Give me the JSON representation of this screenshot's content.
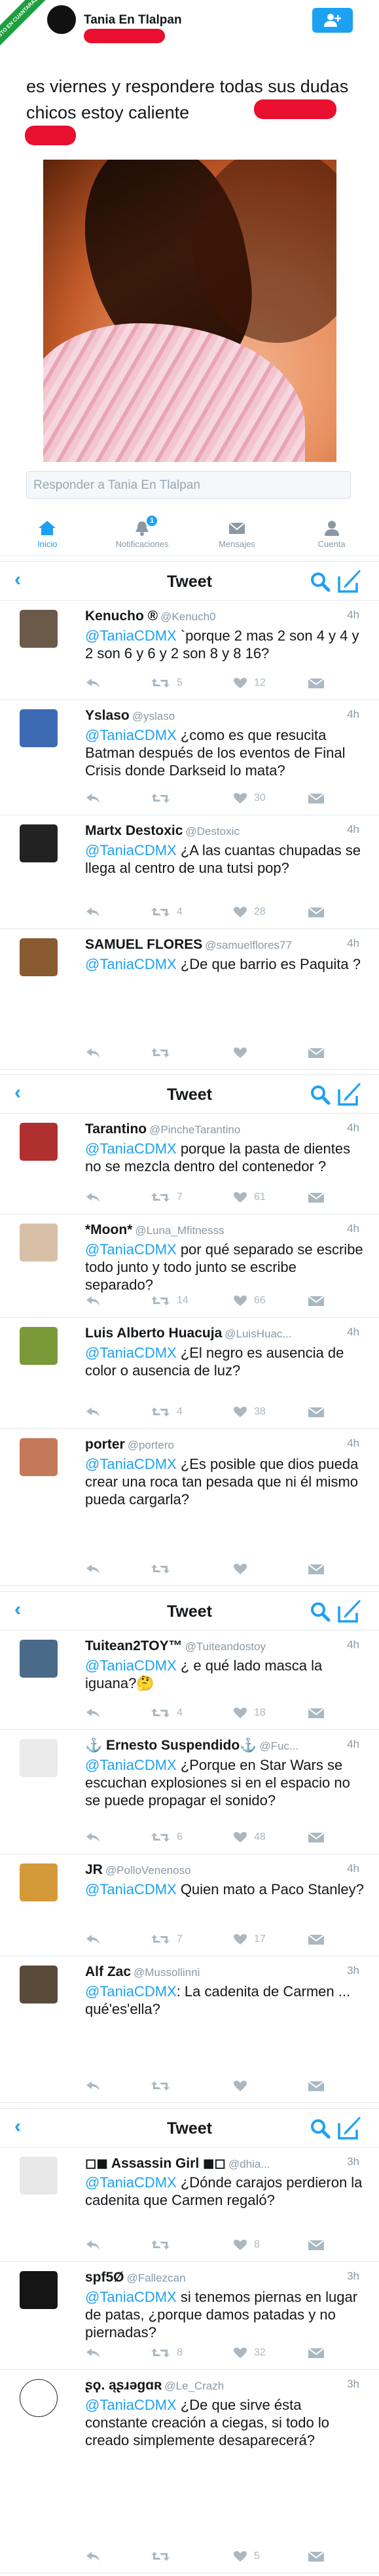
{
  "watermark": "VISTO EN CUANTARAZON",
  "top_tweet": {
    "author": "Tania En Tlalpan",
    "text": "es viernes y respondere todas sus dudas chicos  estoy caliente",
    "reply_placeholder": "Responder a Tania En Tlalpan"
  },
  "tabs": [
    {
      "label": "Inicio",
      "icon": "home-icon"
    },
    {
      "label": "Notificaciones",
      "icon": "bell-icon",
      "badge": "1"
    },
    {
      "label": "Mensajes",
      "icon": "mail-icon"
    },
    {
      "label": "Cuenta",
      "icon": "person-icon"
    }
  ],
  "nav_title": "Tweet",
  "panels": [
    {
      "tweets": [
        {
          "name": "Kenucho ®",
          "handle": "@Kenuch0",
          "time": "4h",
          "mention": "@TaniaCDMX",
          "text": " `porque 2 mas 2 son 4 y 4 y 2 son 6 y 6 y 2 son 8 y 8 16?",
          "retweets": "5",
          "likes": "12"
        },
        {
          "name": "Yslaso",
          "handle": "@yslaso",
          "time": "4h",
          "mention": "@TaniaCDMX",
          "text": " ¿como es que resucita Batman después de los eventos de Final Crisis donde Darkseid lo mata?",
          "retweets": "",
          "likes": "30"
        },
        {
          "name": "Martx Destoxic",
          "handle": "@Destoxic",
          "time": "4h",
          "mention": "@TaniaCDMX",
          "text": " ¿A las cuantas chupadas se llega al centro de una tutsi pop?",
          "retweets": "4",
          "likes": "28"
        },
        {
          "name": "SAMUEL FLORES",
          "handle": "@samuelflores77",
          "time": "4h",
          "mention": "@TaniaCDMX",
          "text": " ¿De que barrio es Paquita ?",
          "retweets": "",
          "likes": ""
        }
      ]
    },
    {
      "tweets": [
        {
          "name": "Tarantino",
          "handle": "@PincheTarantino",
          "time": "4h",
          "mention": "@TaniaCDMX",
          "text": " porque la pasta de dientes no se mezcla dentro del contenedor ?",
          "retweets": "7",
          "likes": "61"
        },
        {
          "name": "*Moon*",
          "handle": "@Luna_Mfitnesss",
          "time": "4h",
          "mention": "@TaniaCDMX",
          "text": " por qué separado se escribe todo junto y todo junto se escribe separado?",
          "retweets": "14",
          "likes": "66"
        },
        {
          "name": "Luis Alberto Huacuja",
          "handle": "@LuisHuac...",
          "time": "4h",
          "mention": "@TaniaCDMX",
          "text": " ¿El negro es ausencia de color o ausencia de luz?",
          "retweets": "4",
          "likes": "38"
        },
        {
          "name": "porter",
          "handle": "@portero",
          "time": "4h",
          "mention": "@TaniaCDMX",
          "text": " ¿Es posible que dios pueda crear una roca tan pesada que ni él mismo pueda cargarla?",
          "retweets": "",
          "likes": ""
        }
      ]
    },
    {
      "tweets": [
        {
          "name": "Tuitean2TOY™",
          "handle": "@Tuiteandostoy",
          "time": "4h",
          "mention": "@TaniaCDMX",
          "text": " ¿ e qué lado masca la iguana?🤔",
          "retweets": "4",
          "likes": "18"
        },
        {
          "name": "⚓ Ernesto Suspendido⚓",
          "handle": "@Fuc...",
          "time": "4h",
          "mention": "@TaniaCDMX",
          "text": " ¿Porque en Star Wars se escuchan explosiones si en el espacio no se puede propagar el sonido?",
          "retweets": "6",
          "likes": "48"
        },
        {
          "name": "JR",
          "handle": "@PolloVenenoso",
          "time": "4h",
          "mention": "@TaniaCDMX",
          "text": " Quien mato a Paco Stanley?",
          "retweets": "7",
          "likes": "17"
        },
        {
          "name": "Alf Zac",
          "handle": "@Mussollinni",
          "time": "3h",
          "mention": "@TaniaCDMX",
          "text": ": La cadenita de Carmen ... qué'es'ella?",
          "retweets": "",
          "likes": ""
        }
      ]
    },
    {
      "tweets": [
        {
          "name": "◻◼ Assassin Girl ◼◻",
          "handle": "@dhia...",
          "time": "3h",
          "mention": "@TaniaCDMX",
          "text": " ¿Dónde carajos perdieron la cadenita que Carmen regaló?",
          "retweets": "",
          "likes": "8"
        },
        {
          "name": "spf5Ø",
          "handle": "@Fallezcan",
          "time": "3h",
          "mention": "@TaniaCDMX",
          "text": " si tenemos piernas en lugar de patas, ¿porque damos patadas y no piernadas?",
          "retweets": "8",
          "likes": "32"
        },
        {
          "name": "ʂϙ. ąʂɹǝɡɑʀ",
          "handle": "@Le_Crazh",
          "time": "3h",
          "mention": "@TaniaCDMX",
          "text": " ¿De que sirve ésta constante creación a ciegas, si todo lo creado simplemente desaparecerá?",
          "retweets": "",
          "likes": "5"
        }
      ]
    }
  ]
}
